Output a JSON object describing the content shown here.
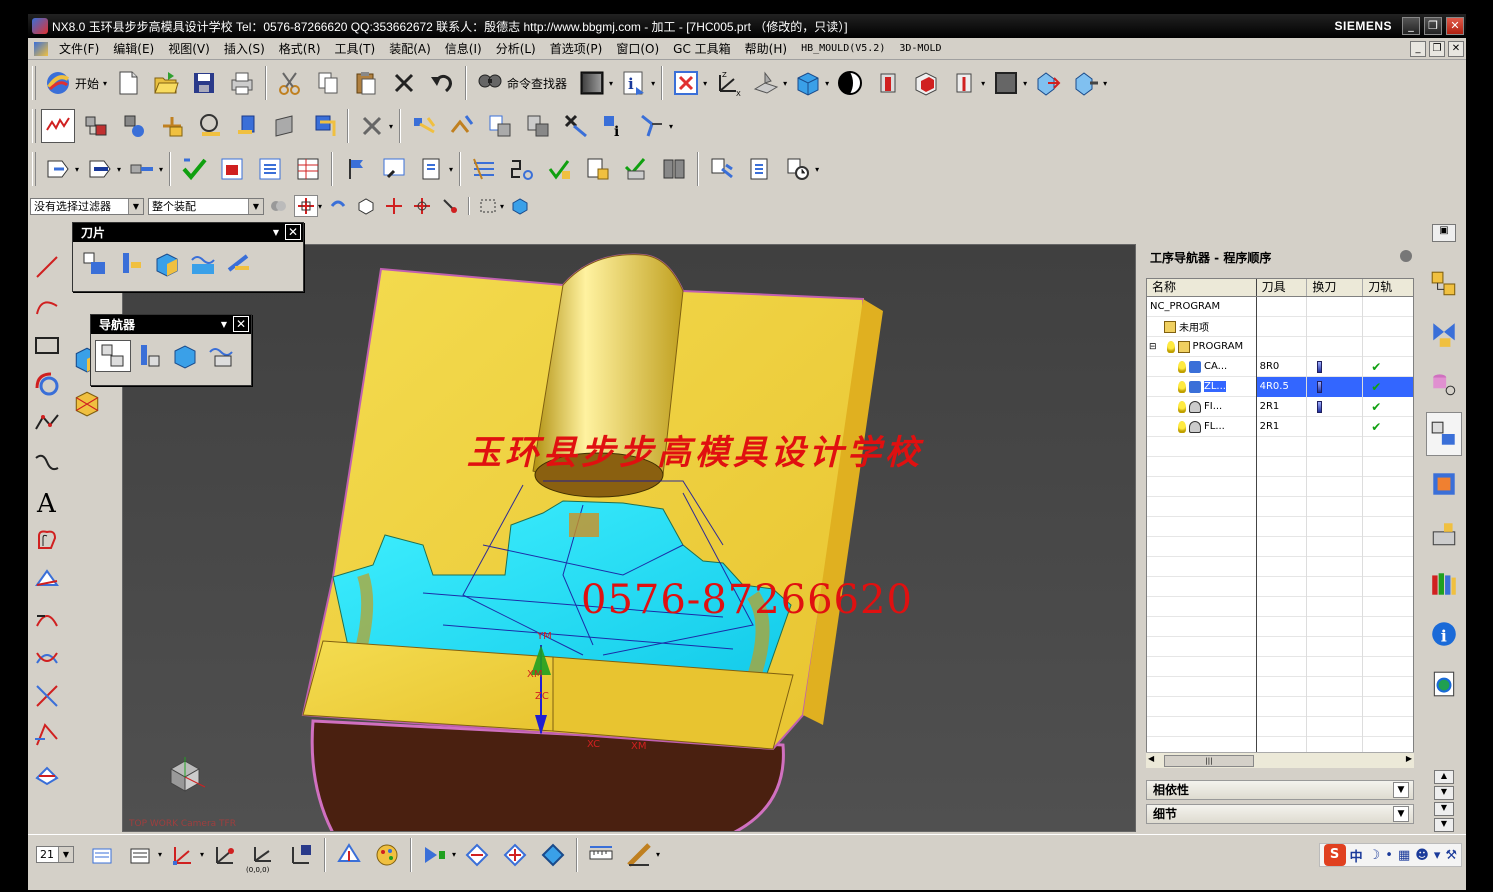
{
  "window": {
    "title": "NX8.0 玉环县步步高模具设计学校  Tel：0576-87266620 QQ:353662672  联系人：殷德志  http://www.bbgmj.com - 加工 - [7HC005.prt （修改的，只读）]",
    "brand": "SIEMENS",
    "min": "_",
    "restore": "❐",
    "close": "✕"
  },
  "menu": {
    "items": [
      "文件(F)",
      "编辑(E)",
      "视图(V)",
      "插入(S)",
      "格式(R)",
      "工具(T)",
      "装配(A)",
      "信息(I)",
      "分析(L)",
      "首选项(P)",
      "窗口(O)",
      "GC 工具箱",
      "帮助(H)",
      "HB_MOULD(V5.2)",
      "3D-MOLD"
    ]
  },
  "toolbar": {
    "start_label": "开始",
    "command_finder_label": "命令查找器"
  },
  "selection": {
    "filter": "没有选择过滤器",
    "scope": "整个装配"
  },
  "palettes": {
    "blade_title": "刀片",
    "navigator_title": "导航器"
  },
  "graphics": {
    "watermark_school": "玉环县步步高模具设计学校",
    "watermark_phone": "0576-87266620",
    "camera_label": "TOP WORK Camera TFR",
    "axis": {
      "ym": "YM",
      "xm_top": "XM",
      "zc": "ZC",
      "xc": "XC",
      "xm": "XM"
    }
  },
  "navigator": {
    "title": "工序导航器 - 程序顺序",
    "columns": [
      "名称",
      "刀具",
      "换刀",
      "刀轨"
    ],
    "rows": [
      {
        "name": "NC_PROGRAM",
        "tool": "",
        "indent": 0,
        "kind": "root",
        "changed": false,
        "path": false,
        "selected": false
      },
      {
        "name": "未用项",
        "tool": "",
        "indent": 1,
        "kind": "folder",
        "changed": false,
        "path": false,
        "selected": false
      },
      {
        "name": "PROGRAM",
        "tool": "",
        "indent": 1,
        "kind": "program",
        "changed": false,
        "path": false,
        "selected": false
      },
      {
        "name": "CA...",
        "tool": "8R0",
        "indent": 2,
        "kind": "op",
        "changed": true,
        "path": true,
        "selected": false
      },
      {
        "name": "ZL...",
        "tool": "4R0.5",
        "indent": 2,
        "kind": "op",
        "changed": true,
        "path": true,
        "selected": true
      },
      {
        "name": "FI...",
        "tool": "2R1",
        "indent": 2,
        "kind": "op2",
        "changed": true,
        "path": true,
        "selected": false
      },
      {
        "name": "FL...",
        "tool": "2R1",
        "indent": 2,
        "kind": "op2",
        "changed": false,
        "path": true,
        "selected": false
      }
    ],
    "scroll_grip": "|||",
    "sections": [
      "相依性",
      "细节"
    ]
  },
  "bottom": {
    "zoom_value": "21",
    "origin_label": "(0,0,0)"
  },
  "ime": {
    "logo": "S",
    "lang": "中"
  }
}
